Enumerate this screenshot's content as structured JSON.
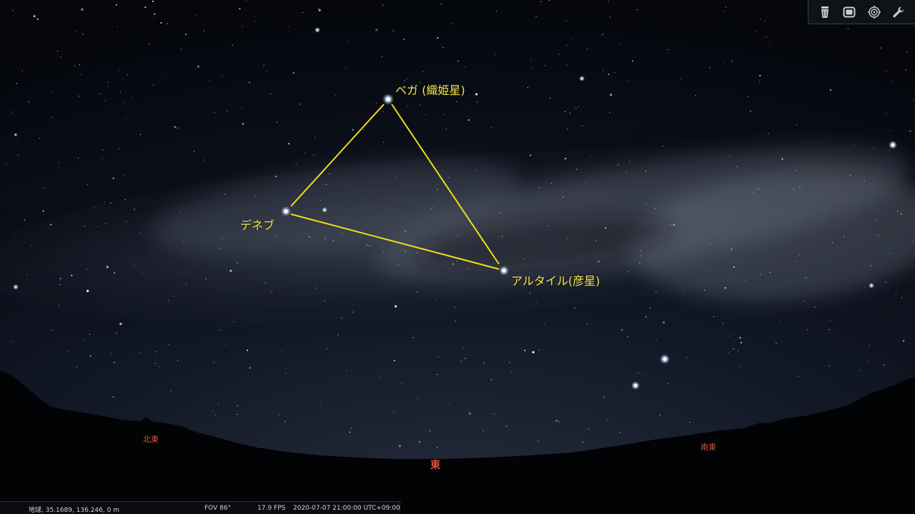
{
  "app": {
    "accent_label_color": "#f6e64a",
    "triangle_line_color": "#f2dd1a",
    "cardinal_color": "#d8533a"
  },
  "stars": {
    "vega": {
      "label": "ベガ (織姫星)"
    },
    "deneb": {
      "label": "デネブ"
    },
    "altair": {
      "label": "アルタイル(彦星)"
    }
  },
  "cardinals": {
    "northeast": "北東",
    "east": "東",
    "southeast": "南東"
  },
  "toolbar": {
    "buttons": [
      {
        "icon": "trash-bin-icon"
      },
      {
        "icon": "window-mode-icon"
      },
      {
        "icon": "target-reticle-icon"
      },
      {
        "icon": "wrench-icon"
      }
    ]
  },
  "statusbar": {
    "location": "地球, 35.1689, 136.246, 0 m",
    "fov": "FOV 86°",
    "fps": "17.9 FPS",
    "datetime": "2020-07-07 21:00:00 UTC+09:00"
  }
}
